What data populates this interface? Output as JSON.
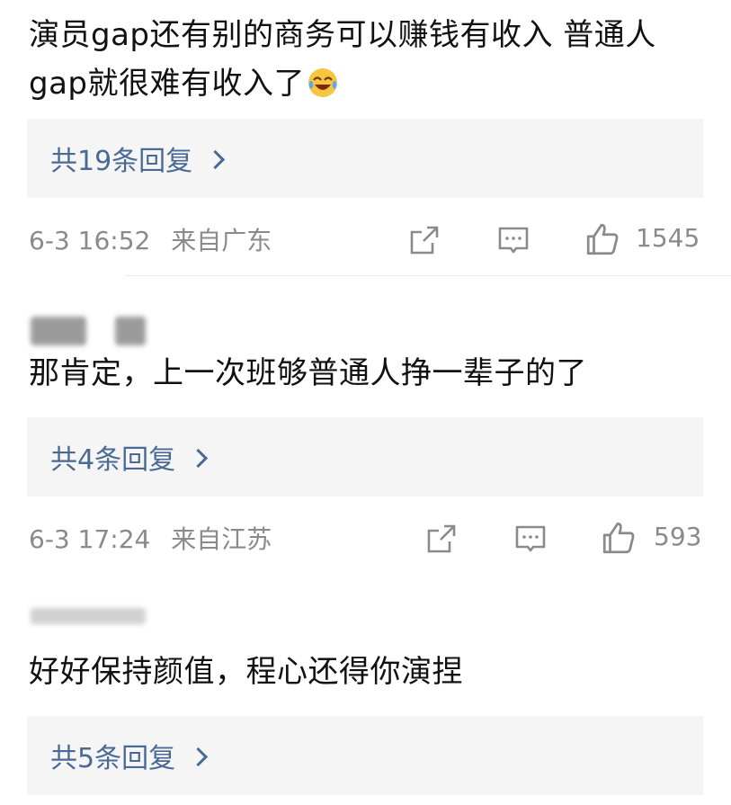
{
  "comments": [
    {
      "text": "演员gap还有别的商务可以赚钱有收入 普通人gap就很难有收入了",
      "emoji": "laughing-tears",
      "reply_label": "共19条回复",
      "time": "6-3 16:52",
      "location": "来自广东",
      "likes": "1545"
    },
    {
      "text": "那肯定，上一次班够普通人挣一辈子的了",
      "reply_label": "共4条回复",
      "time": "6-3 17:24",
      "location": "来自江苏",
      "likes": "593"
    },
    {
      "text": "好好保持颜值，程心还得你演捏",
      "reply_label": "共5条回复"
    }
  ],
  "icons": [
    "share-icon",
    "comment-icon",
    "like-icon",
    "chevron-right-icon"
  ],
  "colors": {
    "reply_link": "#4a6a94",
    "reply_bg": "#f5f5f5",
    "meta_gray": "#8a8a8a"
  }
}
